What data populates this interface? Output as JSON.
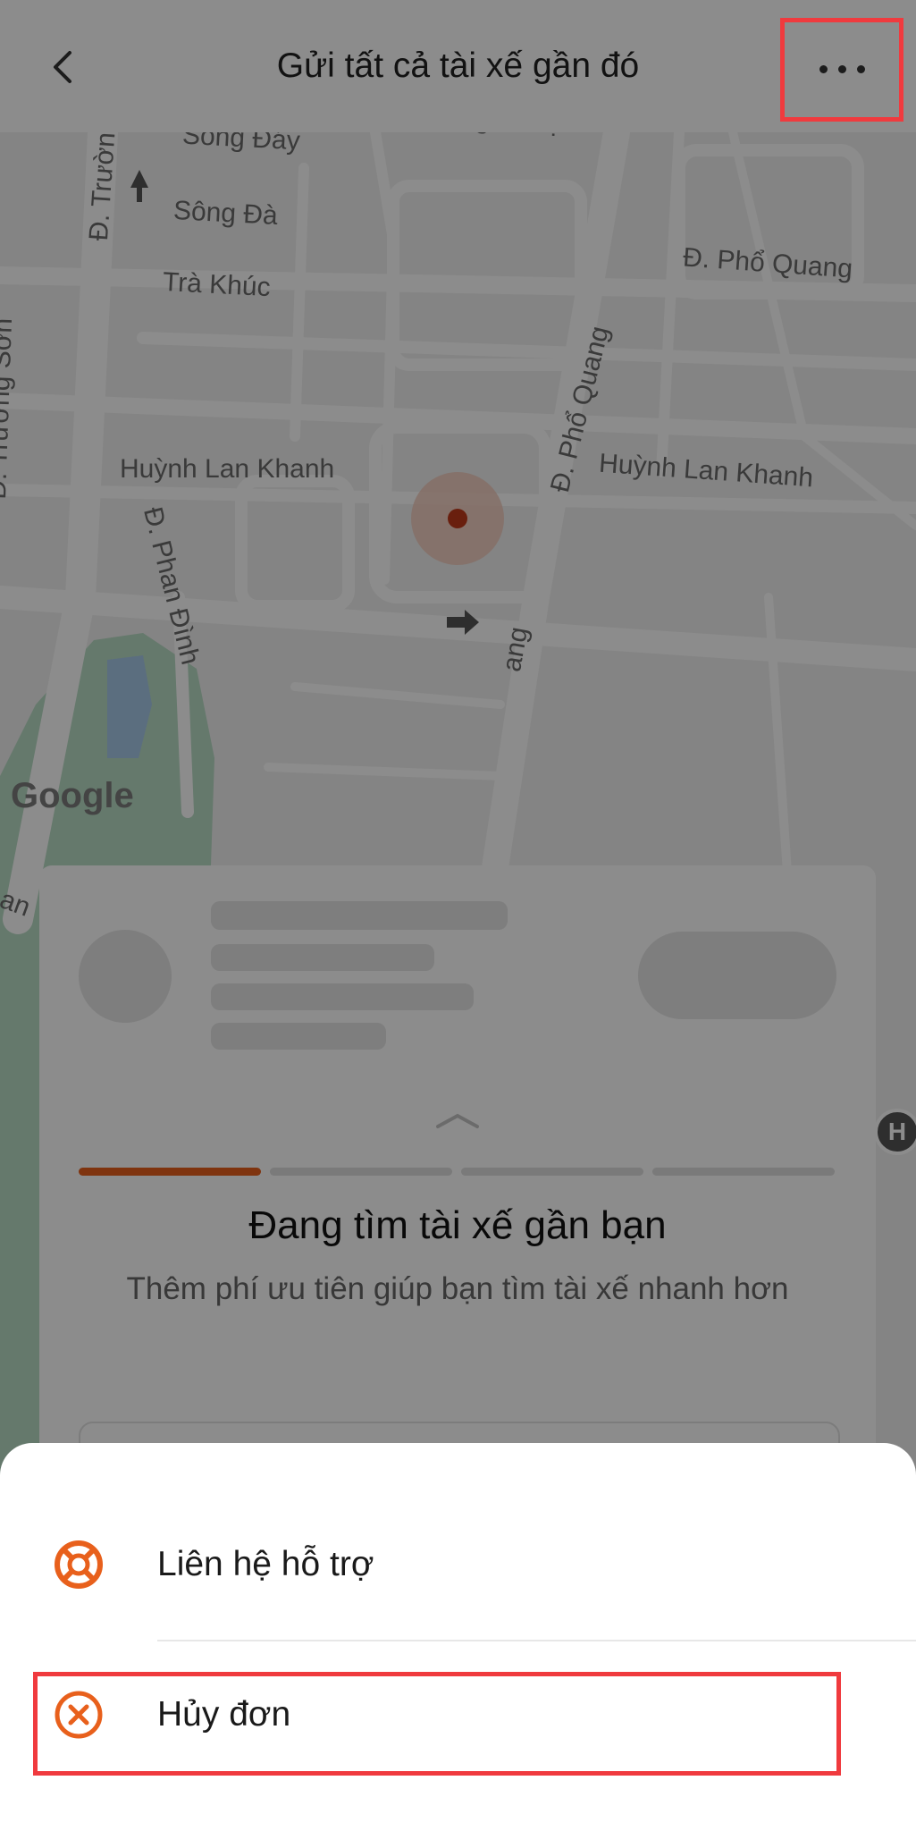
{
  "header": {
    "title": "Gửi tất cả tài xế gần đó"
  },
  "map": {
    "street_labels": [
      "Sông Nhuệ",
      "Sông Đáy",
      "Sông Đà",
      "Trà Khúc",
      "Đ. Phổ Quang",
      "Đ. Trường Sơn",
      "Đ. Trường Sơ",
      "Huỳnh Lan Khanh",
      "Huỳnh Lan Khanh",
      "Đ. Phổ Quang",
      "Đ. Phan Đình",
      "ang",
      "an"
    ],
    "google_logo": "Google",
    "hospital_marker": "H"
  },
  "trip_card": {
    "status_title": "Đang tìm tài xế gần bạn",
    "status_subtitle": "Thêm phí ưu tiên giúp bạn tìm tài xế nhanh hơn",
    "progress": {
      "total_steps": 4,
      "active_step": 1
    }
  },
  "bottom_sheet": {
    "items": [
      {
        "label": "Liên hệ hỗ trợ",
        "icon": "lifebuoy-icon"
      },
      {
        "label": "Hủy đơn",
        "icon": "cancel-circle-icon"
      }
    ]
  },
  "colors": {
    "accent": "#e8601c",
    "highlight": "#f03a3e",
    "pin": "#c0391b"
  }
}
